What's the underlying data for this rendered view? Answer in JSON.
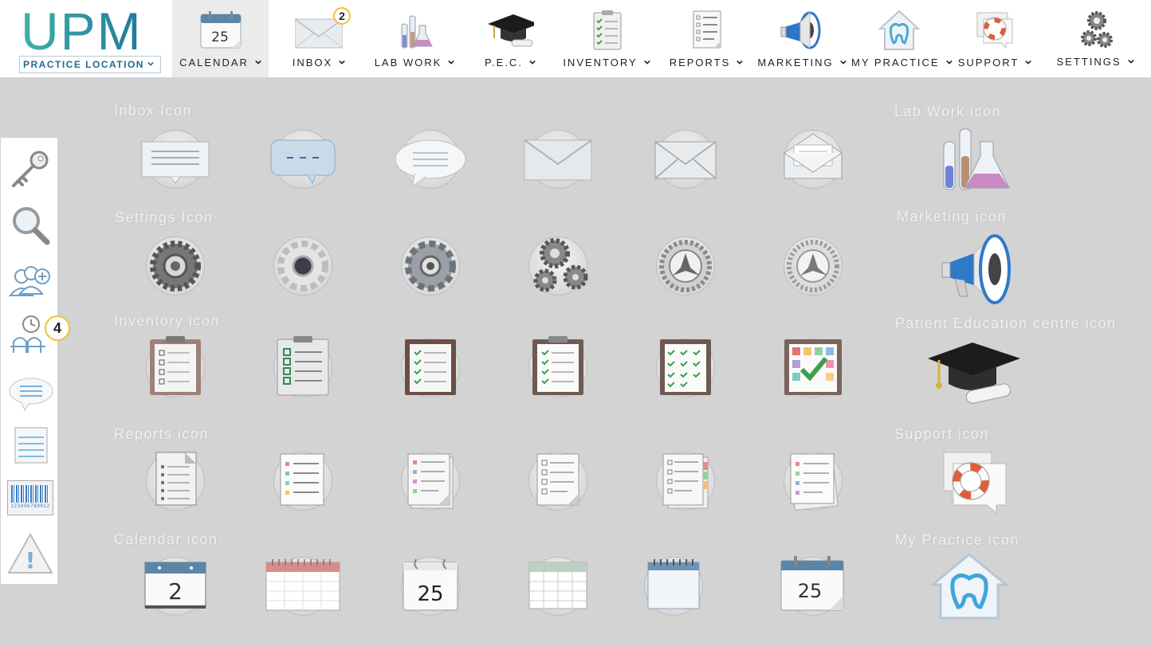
{
  "logo": {
    "text": "UPM",
    "location_label": "PRACTICE LOCATION"
  },
  "nav": [
    {
      "label": "CALENDAR",
      "icon": "calendar-icon",
      "calendar_day": "25"
    },
    {
      "label": "INBOX",
      "icon": "envelope-icon",
      "badge": "2"
    },
    {
      "label": "LAB WORK",
      "icon": "lab-flask-icon"
    },
    {
      "label": "P.E.C.",
      "icon": "graduation-cap-icon"
    },
    {
      "label": "INVENTORY",
      "icon": "clipboard-checklist-icon"
    },
    {
      "label": "REPORTS",
      "icon": "report-list-icon"
    },
    {
      "label": "MARKETING",
      "icon": "megaphone-icon"
    },
    {
      "label": "MY PRACTICE",
      "icon": "tooth-house-icon"
    },
    {
      "label": "SUPPORT",
      "icon": "lifebuoy-icon"
    },
    {
      "label": "SETTINGS",
      "icon": "gears-icon"
    }
  ],
  "sidebar": {
    "items": [
      {
        "icon": "key-icon"
      },
      {
        "icon": "magnifier-icon"
      },
      {
        "icon": "add-patient-icon"
      },
      {
        "icon": "waiting-room-icon",
        "badge": "4"
      },
      {
        "icon": "speech-bubble-icon"
      },
      {
        "icon": "note-lines-icon"
      },
      {
        "icon": "barcode-icon",
        "barcode_text": "123456789012"
      },
      {
        "icon": "warning-icon",
        "symbol": "!"
      }
    ]
  },
  "sections": {
    "inbox": {
      "title": "Inbox Icon"
    },
    "settings": {
      "title": "Settings Icon"
    },
    "inventory": {
      "title": "Inventory icon"
    },
    "reports": {
      "title": "Reports icon"
    },
    "calendar": {
      "title": "Calendar icon",
      "days": [
        "2",
        "25",
        "25"
      ]
    },
    "lab_work": {
      "title": "Lab Work icon"
    },
    "marketing": {
      "title": "Marketing icon"
    },
    "pec": {
      "title": "Patient Education centre icon"
    },
    "support": {
      "title": "Support icon"
    },
    "my_practice": {
      "title": "My Practice icon"
    }
  }
}
